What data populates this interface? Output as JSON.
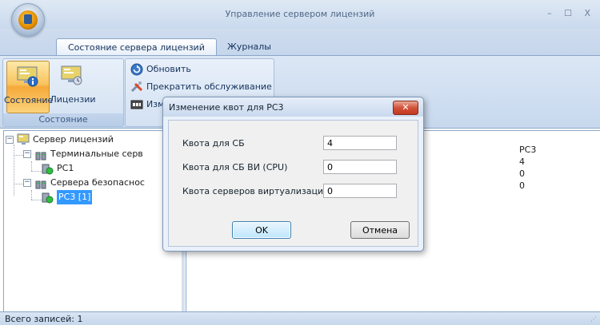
{
  "window": {
    "title": "Управление сервером лицензий",
    "controls": "– ☐ X"
  },
  "ribbon": {
    "tabs": [
      {
        "label": "Состояние сервера лицензий",
        "active": true
      },
      {
        "label": "Журналы",
        "active": false
      }
    ],
    "state_group": {
      "label": "Состояние",
      "buttons": [
        {
          "label": "Состояние",
          "icon": "server-status-icon",
          "selected": true
        },
        {
          "label": "Лицензии",
          "icon": "licenses-icon",
          "selected": false
        }
      ]
    },
    "actions": [
      {
        "label": "Обновить",
        "icon": "refresh-icon"
      },
      {
        "label": "Прекратить обслуживание",
        "icon": "stop-service-icon"
      },
      {
        "label": "Изм",
        "icon": "edit-quota-icon"
      }
    ]
  },
  "tree": {
    "root": {
      "label": "Сервер лицензий"
    },
    "groups": [
      {
        "label": "Терминальные серв",
        "children": [
          {
            "label": "PC1",
            "selected": false
          }
        ]
      },
      {
        "label": "Сервера безопаснос",
        "children": [
          {
            "label": "PC3 [1]",
            "selected": true
          }
        ]
      }
    ]
  },
  "details": {
    "values": [
      "PC3",
      "4",
      "0",
      "0"
    ]
  },
  "status": {
    "text": "Всего записей: 1"
  },
  "dialog": {
    "title": "Изменение квот для  PC3",
    "close_glyph": "✕",
    "fields": [
      {
        "label": "Квота для СБ",
        "value": "4"
      },
      {
        "label": "Квота для СБ ВИ (CPU)",
        "value": "0"
      },
      {
        "label": "Квота серверов виртуализации",
        "value": "0"
      }
    ],
    "ok_label": "OK",
    "cancel_label": "Отмена"
  },
  "colors": {
    "selection": "#3399ff",
    "ribbon_selected": "#f9c35c",
    "close_button": "#d2533a"
  }
}
